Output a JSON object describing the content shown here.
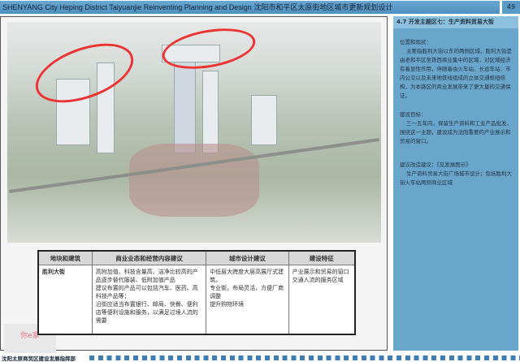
{
  "header": {
    "title": "SHENYANG City Heping District Taiyuanjie Reinventing Planning and Design 沈阳市和平区太原街地区城市更新规划设计",
    "page": "49"
  },
  "table": {
    "headers": [
      "地块和建筑",
      "商业业态和经营内容建议",
      "城市设计建议",
      "建设特征"
    ],
    "row": {
      "name": "胜利大街",
      "commerce": [
        "高附加值、科技含量高、洁净比较高的产品逐步替代服装、低附加值产品",
        "建议布置的产品可以包括汽车、医药、高科技产品等；",
        "沿街应适当布置银行、邮局、快餐、便利店等便利设施和服务，以满足过境人流的需要"
      ],
      "design": [
        "中低层大跨度大层高展厅式建筑。",
        "专业街，布局灵活，方便厂商调整",
        "提升购物环境"
      ],
      "features": [
        "产业展示和贸易的窗口",
        "交通人流的服务区域"
      ]
    }
  },
  "right": {
    "title": "4.7 开发主题区七：生产资料贸易大街",
    "sections": [
      {
        "h": "位置和现状：",
        "b": "主要指胜利大街以东的两侧区域，胜利大街是由老和平区至铁西商业集中的区域，对区域经济有着显性作用，伴随着由火车站、长途车站、市内公交以及未来地铁线组成的立体交通枢纽结构，为本路区的商业发展带来了更大量的交通保证。"
      },
      {
        "h": "建设目标：",
        "b": "三～五年内，保留生产资料和工业产品批发，围绕这一主题，建设成为沈阳重要的产业展示和贸易的窗口。"
      },
      {
        "h": "建议改造建议：《见发展图示》",
        "b": "生产资料贸易大街广场城市设计；包括胜利大街火车站两侧商业区域"
      }
    ]
  },
  "footer": {
    "text": "沈阳太原商贸区建设发展指挥部"
  },
  "watermark": "你e家"
}
